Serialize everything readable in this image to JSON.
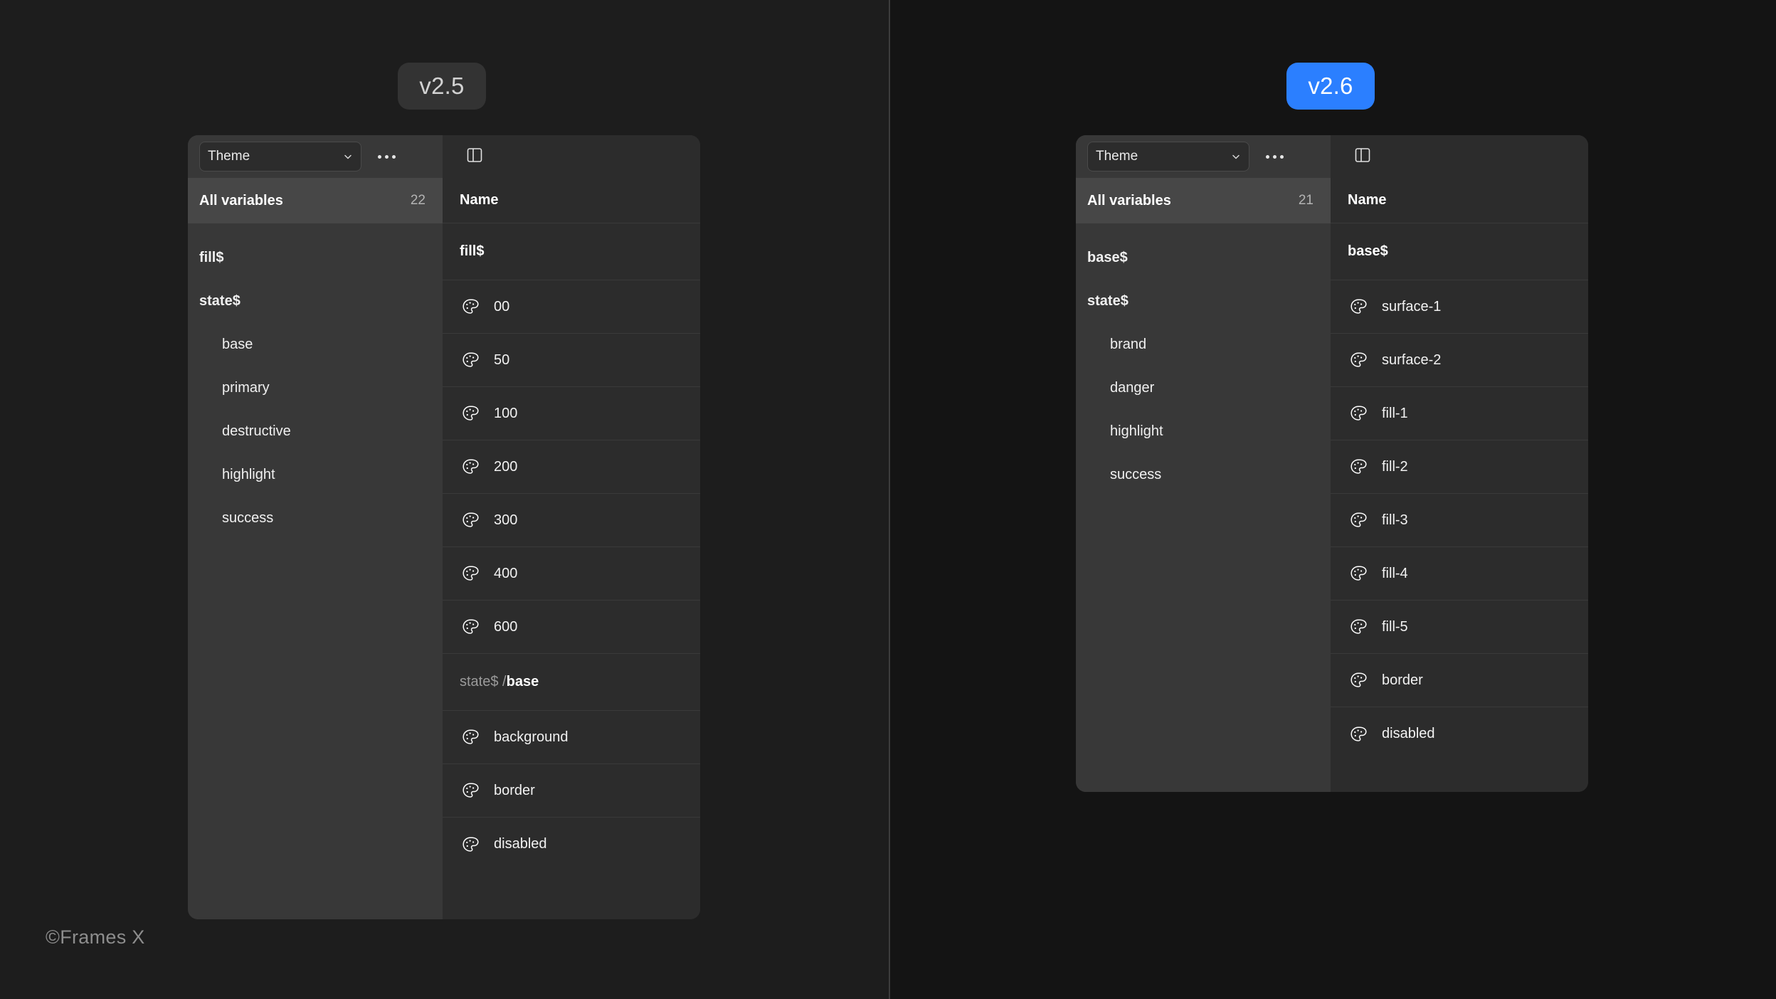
{
  "canvas": {
    "background_left": "#1d1d1d",
    "background_right": "#141414",
    "watermark": "©Frames X"
  },
  "accent_color": "#2b7fff",
  "panels": [
    {
      "id": "v2-5",
      "badge": {
        "label": "v2.5",
        "background": "#333333",
        "text_color": "#d2d2d2"
      },
      "toolbar": {
        "theme_select_value": "Theme",
        "theme_select_placeholder": "Theme",
        "more_label": "•••",
        "layout_toggle_label": "Toggle panel"
      },
      "sidebar": {
        "header_label": "All variables",
        "header_count": "22",
        "items": [
          {
            "label": "fill$",
            "level": 0
          },
          {
            "label": "state$",
            "level": 0
          },
          {
            "label": "base",
            "level": 1
          },
          {
            "label": "primary",
            "level": 1
          },
          {
            "label": "destructive",
            "level": 1
          },
          {
            "label": "highlight",
            "level": 1
          },
          {
            "label": "success",
            "level": 1
          }
        ]
      },
      "table": {
        "column_header": "Name",
        "rows": [
          {
            "type": "group",
            "prefix": "",
            "leaf": "fill$"
          },
          {
            "type": "variable",
            "name": "00",
            "icon": "palette-icon"
          },
          {
            "type": "variable",
            "name": "50",
            "icon": "palette-icon"
          },
          {
            "type": "variable",
            "name": "100",
            "icon": "palette-icon"
          },
          {
            "type": "variable",
            "name": "200",
            "icon": "palette-icon"
          },
          {
            "type": "variable",
            "name": "300",
            "icon": "palette-icon"
          },
          {
            "type": "variable",
            "name": "400",
            "icon": "palette-icon"
          },
          {
            "type": "variable",
            "name": "600",
            "icon": "palette-icon"
          },
          {
            "type": "group",
            "prefix": "state$ / ",
            "leaf": "base"
          },
          {
            "type": "variable",
            "name": "background",
            "icon": "palette-icon"
          },
          {
            "type": "variable",
            "name": "border",
            "icon": "palette-icon"
          },
          {
            "type": "variable",
            "name": "disabled",
            "icon": "palette-icon"
          }
        ]
      }
    },
    {
      "id": "v2-6",
      "badge": {
        "label": "v2.6",
        "background": "#2b7fff",
        "text_color": "#ffffff"
      },
      "toolbar": {
        "theme_select_value": "Theme",
        "theme_select_placeholder": "Theme",
        "more_label": "•••",
        "layout_toggle_label": "Toggle panel"
      },
      "sidebar": {
        "header_label": "All variables",
        "header_count": "21",
        "items": [
          {
            "label": "base$",
            "level": 0
          },
          {
            "label": "state$",
            "level": 0
          },
          {
            "label": "brand",
            "level": 1
          },
          {
            "label": "danger",
            "level": 1
          },
          {
            "label": "highlight",
            "level": 1
          },
          {
            "label": "success",
            "level": 1
          }
        ]
      },
      "table": {
        "column_header": "Name",
        "rows": [
          {
            "type": "group",
            "prefix": "",
            "leaf": "base$"
          },
          {
            "type": "variable",
            "name": "surface-1",
            "icon": "palette-icon"
          },
          {
            "type": "variable",
            "name": "surface-2",
            "icon": "palette-icon"
          },
          {
            "type": "variable",
            "name": "fill-1",
            "icon": "palette-icon"
          },
          {
            "type": "variable",
            "name": "fill-2",
            "icon": "palette-icon"
          },
          {
            "type": "variable",
            "name": "fill-3",
            "icon": "palette-icon"
          },
          {
            "type": "variable",
            "name": "fill-4",
            "icon": "palette-icon"
          },
          {
            "type": "variable",
            "name": "fill-5",
            "icon": "palette-icon"
          },
          {
            "type": "variable",
            "name": "border",
            "icon": "palette-icon"
          },
          {
            "type": "variable",
            "name": "disabled",
            "icon": "palette-icon"
          }
        ]
      }
    }
  ]
}
